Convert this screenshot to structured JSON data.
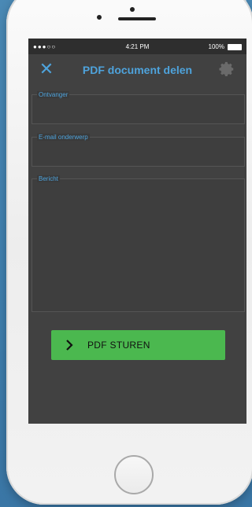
{
  "status_bar": {
    "signal": "●●●○○",
    "time": "4:21 PM",
    "battery": "100%"
  },
  "nav": {
    "title": "PDF document delen",
    "close_icon": "✕"
  },
  "form": {
    "recipient_label": "Ontvanger",
    "recipient_value": "",
    "subject_label": "E-mail onderwerp",
    "subject_value": "",
    "message_label": "Bericht",
    "message_value": ""
  },
  "send_button": {
    "label": "PDF STUREN"
  },
  "colors": {
    "accent_blue": "#4ea3dc",
    "send_green": "#4bb84f",
    "screen_bg": "#414141"
  }
}
